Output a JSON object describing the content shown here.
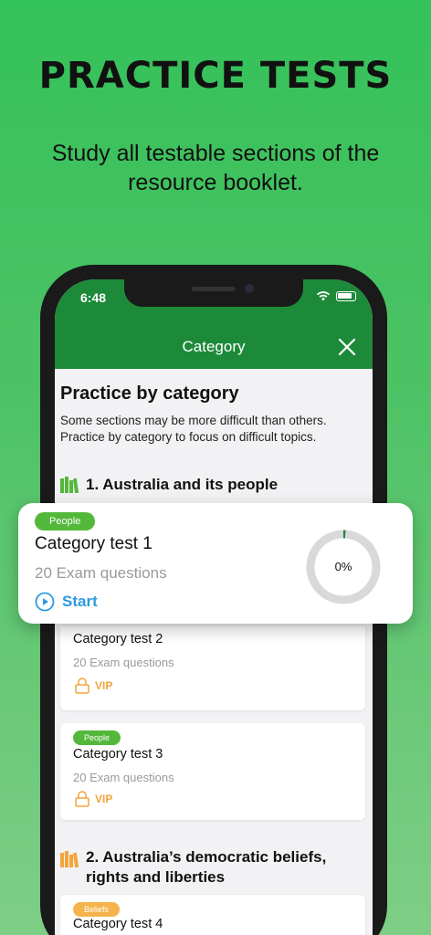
{
  "promo": {
    "title": "PRACTICE TESTS",
    "subtitle": "Study all testable sections of the resource booklet."
  },
  "status_bar": {
    "time": "6:48",
    "icons": [
      "wifi-icon",
      "battery-icon"
    ]
  },
  "nav": {
    "title": "Category",
    "close_icon": "close-icon"
  },
  "section": {
    "heading": "Practice by category",
    "description": "Some sections may be more difficult than others. Practice by category to focus on difficult topics."
  },
  "categories": [
    {
      "title": "1. Australia and its people",
      "icon": "books-icon",
      "icon_color": "#53b83a",
      "tests": [
        {
          "tag": "People",
          "title": "Category test 2",
          "questions": "20 Exam questions",
          "badge": "VIP"
        },
        {
          "tag": "People",
          "title": "Category test 3",
          "questions": "20 Exam questions",
          "badge": "VIP"
        }
      ]
    },
    {
      "title": "2. Australia’s democratic beliefs, rights and liberties",
      "icon": "books-icon",
      "icon_color": "#f2a53a",
      "tests": [
        {
          "tag": "Beliefs",
          "title": "Category test 4"
        }
      ]
    }
  ],
  "featured": {
    "tag": "People",
    "title": "Category test 1",
    "questions": "20 Exam questions",
    "action": "Start",
    "progress_label": "0%",
    "progress": 0.01
  },
  "colors": {
    "brand_green": "#1d8a3a",
    "people_tag": "#53b83a",
    "beliefs_tag": "#f5b34c",
    "vip": "#f2a53a",
    "start": "#2d9be0"
  }
}
